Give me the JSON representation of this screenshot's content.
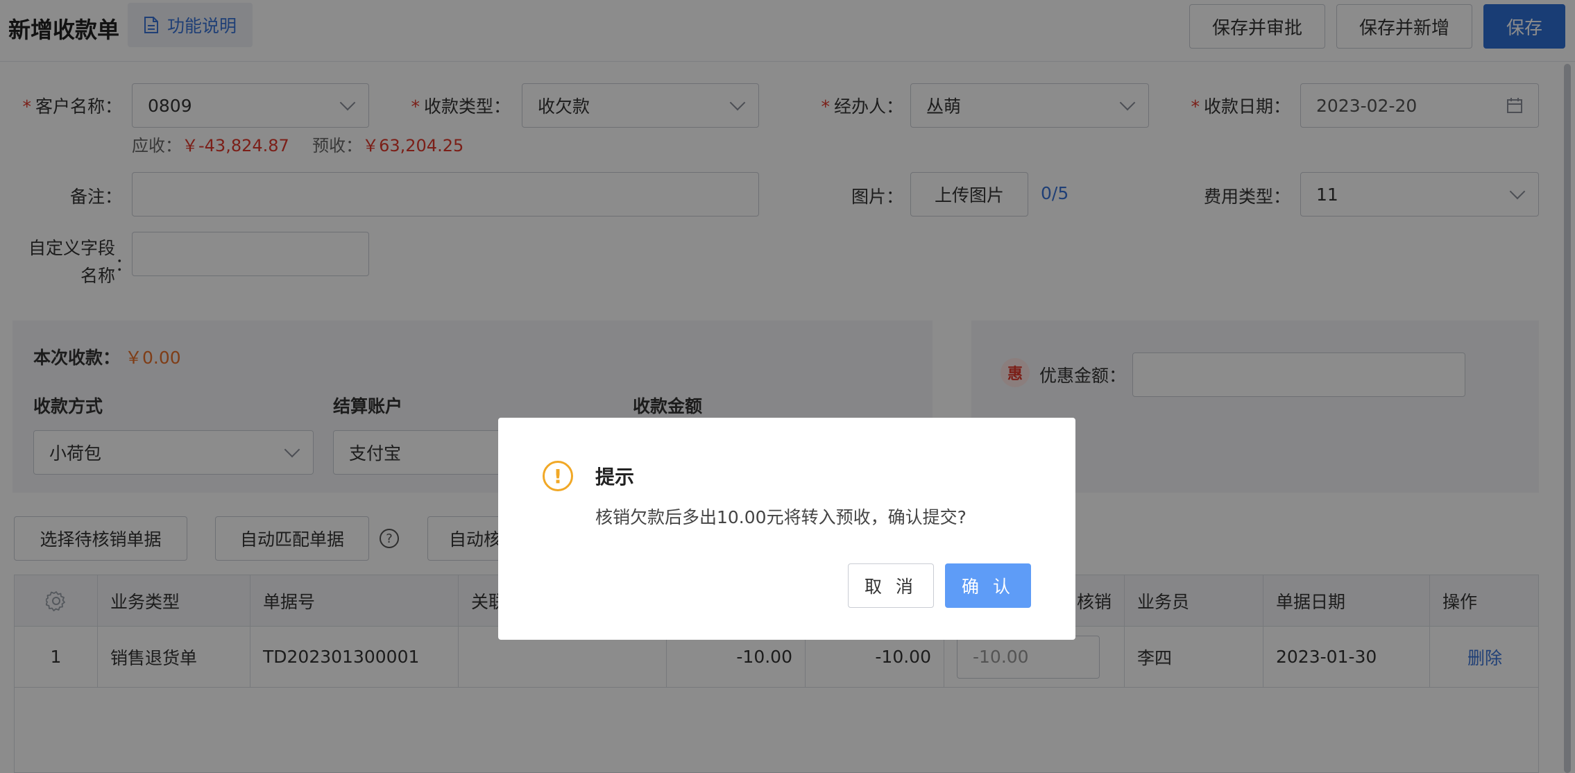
{
  "header": {
    "title": "新增收款单",
    "help_label": "功能说明",
    "save_approve_label": "保存并审批",
    "save_new_label": "保存并新增",
    "save_label": "保存"
  },
  "form": {
    "customer": {
      "label": "客户名称：",
      "value": "0809",
      "required": true
    },
    "receipt_type": {
      "label": "收款类型：",
      "value": "收欠款",
      "required": true
    },
    "handler": {
      "label": "经办人：",
      "value": "丛萌",
      "required": true
    },
    "receipt_date": {
      "label": "收款日期：",
      "value": "2023-02-20",
      "required": true
    },
    "receivable_label": "应收：",
    "receivable_value": "￥-43,824.87",
    "prepaid_label": "预收：",
    "prepaid_value": "￥63,204.25",
    "remark": {
      "label": "备注：",
      "value": ""
    },
    "image": {
      "label": "图片：",
      "upload_label": "上传图片",
      "count": "0/5"
    },
    "fee_type": {
      "label": "费用类型：",
      "value": "11"
    },
    "custom_field": {
      "label_line1": "自定义字段",
      "label_line2": "名称",
      "colon": "：",
      "value": ""
    }
  },
  "payment": {
    "this_receipt_label": "本次收款：",
    "this_receipt_value": "￥0.00",
    "method_label": "收款方式",
    "method_value": "小荷包",
    "account_label": "结算账户",
    "account_value": "支付宝",
    "amount_label": "收款金额",
    "discount_icon": "惠",
    "discount_label": "优惠金额："
  },
  "actions": {
    "select_docs": "选择待核销单据",
    "auto_match": "自动匹配单据",
    "auto_verify_partial": "自动核"
  },
  "table": {
    "columns": [
      "业务类型",
      "单据号",
      "关联",
      "核销",
      "业务员",
      "单据日期",
      "操作"
    ],
    "rows": [
      {
        "index": "1",
        "biz_type": "销售退货单",
        "doc_no": "TD202301300001",
        "related": "",
        "amount1": "-10.00",
        "amount2": "-10.00",
        "verify_input": "-10.00",
        "salesman": "李四",
        "doc_date": "2023-01-30",
        "action": "删除"
      }
    ]
  },
  "dialog": {
    "title": "提示",
    "message": "核销欠款后多出10.00元将转入预收，确认提交?",
    "cancel_label": "取 消",
    "confirm_label": "确 认"
  },
  "colors": {
    "primary": "#2f6fd6",
    "required": "#e0392d",
    "warning": "#f1a826",
    "amount_orange": "#e8702a"
  }
}
